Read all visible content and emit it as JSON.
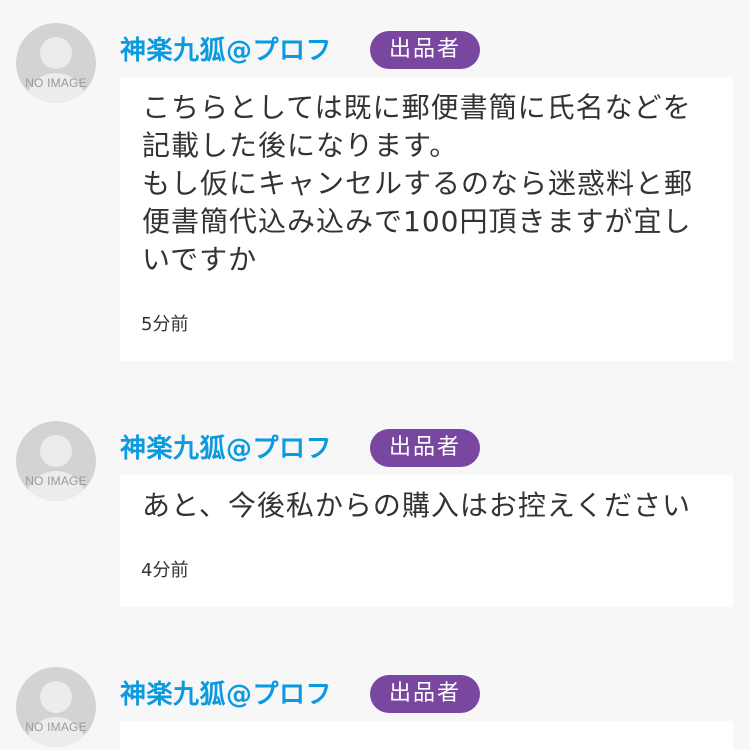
{
  "avatar_text": "NO IMAGE",
  "colors": {
    "username": "#0a9ae0",
    "seller_badge": "#7a47a0",
    "background": "#f7f7f7",
    "bubble": "#ffffff"
  },
  "comments": [
    {
      "username": "神楽九狐@プロフ",
      "badge": "出品者",
      "message": "こちらとしては既に郵便書簡に氏名などを\n記載した後になります。\nもし仮にキャンセルするのなら迷惑料と郵\n便書簡代込み込みで100円頂きますが宜し\nいですか",
      "time": "5分前"
    },
    {
      "username": "神楽九狐@プロフ",
      "badge": "出品者",
      "message": "あと、今後私からの購入はお控えください",
      "time": "4分前"
    },
    {
      "username": "神楽九狐@プロフ",
      "badge": "出品者",
      "message": "",
      "time": ""
    }
  ]
}
